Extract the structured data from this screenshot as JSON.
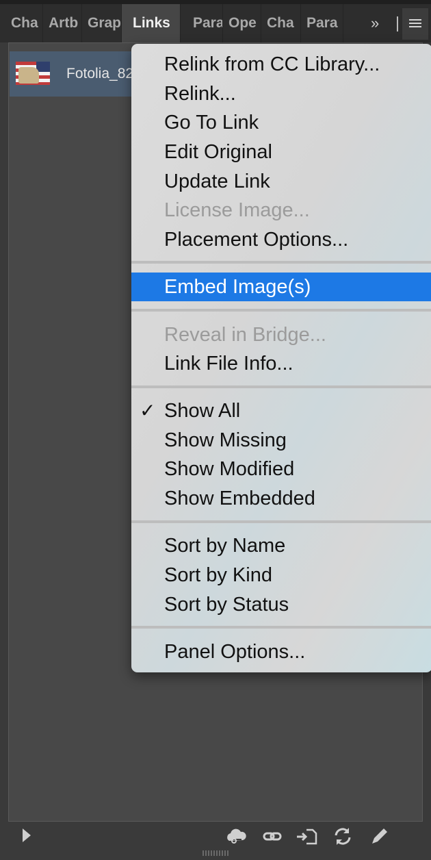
{
  "tabs": [
    "Cha",
    "Artb",
    "Grap",
    "Links",
    "Para",
    "Ope",
    "Cha",
    "Para"
  ],
  "tab_overflow": "»",
  "link_item": {
    "name": "Fotolia_82"
  },
  "menu": {
    "items": [
      {
        "label": "Relink from CC Library...",
        "state": "enabled"
      },
      {
        "label": "Relink...",
        "state": "enabled"
      },
      {
        "label": "Go To Link",
        "state": "enabled"
      },
      {
        "label": "Edit Original",
        "state": "enabled"
      },
      {
        "label": "Update Link",
        "state": "enabled"
      },
      {
        "label": "License Image...",
        "state": "disabled"
      },
      {
        "label": "Placement Options...",
        "state": "enabled"
      },
      {
        "label": "Embed Image(s)",
        "state": "highlighted"
      },
      {
        "label": "Reveal in Bridge...",
        "state": "disabled"
      },
      {
        "label": "Link File Info...",
        "state": "enabled"
      },
      {
        "label": "Show All",
        "state": "checked"
      },
      {
        "label": "Show Missing",
        "state": "enabled"
      },
      {
        "label": "Show Modified",
        "state": "enabled"
      },
      {
        "label": "Show Embedded",
        "state": "enabled"
      },
      {
        "label": "Sort by Name",
        "state": "enabled"
      },
      {
        "label": "Sort by Kind",
        "state": "enabled"
      },
      {
        "label": "Sort by Status",
        "state": "enabled"
      },
      {
        "label": "Panel Options...",
        "state": "enabled"
      }
    ],
    "checkmark": "✓",
    "highlight_color": "#1d79e5"
  },
  "bottom_icons": [
    "play-icon",
    "cc-library-icon",
    "link-icon",
    "place-icon",
    "update-link-icon",
    "edit-original-icon"
  ]
}
